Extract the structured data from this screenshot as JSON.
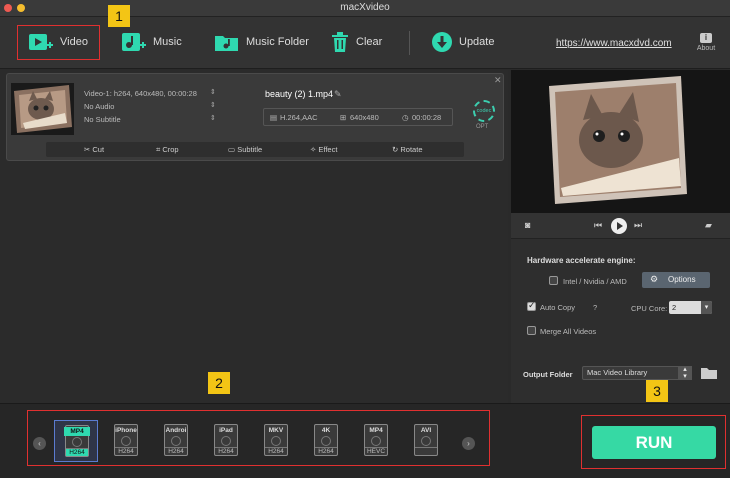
{
  "window": {
    "title": "macXvideo"
  },
  "toolbar": {
    "video_label": "Video",
    "music_label": "Music",
    "music_folder_label": "Music Folder",
    "clear_label": "Clear",
    "update_label": "Update",
    "website_link": "https://www.macxdvd.com",
    "about_label": "About",
    "about_glyph": "i"
  },
  "file": {
    "video_info": "Video-1: h264, 640x480, 00:00:28",
    "audio_info": "No Audio",
    "subtitle_info": "No Subtitle",
    "output_name": "beauty (2) 1.mp4",
    "codec": "H.264,AAC",
    "resolution": "640x480",
    "duration": "00:00:28",
    "codec_badge": "codec",
    "codec_option": "OPT",
    "edit": {
      "cut": "Cut",
      "crop": "Crop",
      "subtitle": "Subtitle",
      "effect": "Effect",
      "rotate": "Rotate"
    }
  },
  "settings": {
    "hw_title": "Hardware accelerate engine:",
    "hw_option": "Intel / Nvidia / AMD",
    "options_button": "Options",
    "auto_copy": "Auto Copy",
    "cpu_core_label": "CPU Core:",
    "cpu_core_value": "2",
    "merge_all": "Merge All Videos",
    "output_folder_label": "Output Folder",
    "output_folder_value": "Mac Video Library"
  },
  "formats": [
    {
      "top": "MP4",
      "bottom": "H264",
      "selected": true
    },
    {
      "top": "iPhone",
      "bottom": "H264",
      "selected": false
    },
    {
      "top": "Androi",
      "bottom": "H264",
      "selected": false
    },
    {
      "top": "iPad",
      "bottom": "H264",
      "selected": false
    },
    {
      "top": "MKV",
      "bottom": "H264",
      "selected": false
    },
    {
      "top": "4K",
      "bottom": "H264",
      "selected": false
    },
    {
      "top": "MP4",
      "bottom": "HEVC",
      "selected": false
    },
    {
      "top": "AVI",
      "bottom": "",
      "selected": false
    }
  ],
  "run_label": "RUN",
  "annotations": {
    "step1": "1",
    "step2": "2",
    "step3": "3"
  },
  "colors": {
    "accent": "#36d9a4",
    "highlight": "#e03030",
    "badge": "#f3c515"
  }
}
